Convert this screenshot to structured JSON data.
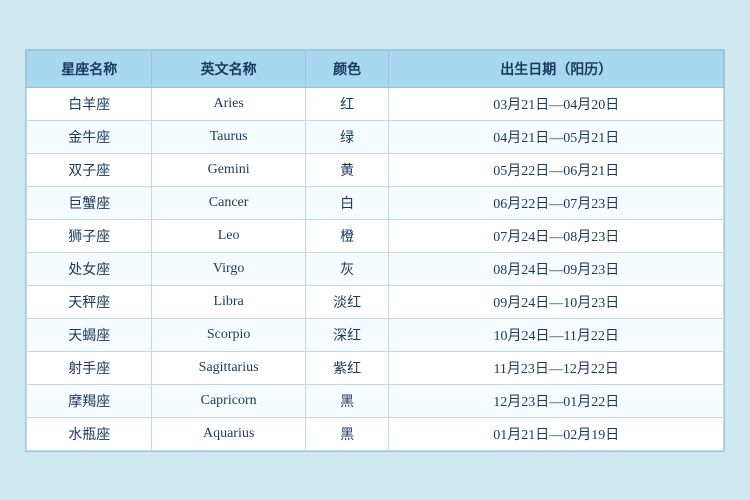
{
  "table": {
    "headers": [
      {
        "id": "col-chinese-name",
        "label": "星座名称"
      },
      {
        "id": "col-english-name",
        "label": "英文名称"
      },
      {
        "id": "col-color",
        "label": "颜色"
      },
      {
        "id": "col-birth-date",
        "label": "出生日期（阳历）"
      }
    ],
    "rows": [
      {
        "chinese": "白羊座",
        "english": "Aries",
        "color": "红",
        "date": "03月21日—04月20日"
      },
      {
        "chinese": "金牛座",
        "english": "Taurus",
        "color": "绿",
        "date": "04月21日—05月21日"
      },
      {
        "chinese": "双子座",
        "english": "Gemini",
        "color": "黄",
        "date": "05月22日—06月21日"
      },
      {
        "chinese": "巨蟹座",
        "english": "Cancer",
        "color": "白",
        "date": "06月22日—07月23日"
      },
      {
        "chinese": "狮子座",
        "english": "Leo",
        "color": "橙",
        "date": "07月24日—08月23日"
      },
      {
        "chinese": "处女座",
        "english": "Virgo",
        "color": "灰",
        "date": "08月24日—09月23日"
      },
      {
        "chinese": "天秤座",
        "english": "Libra",
        "color": "淡红",
        "date": "09月24日—10月23日"
      },
      {
        "chinese": "天蝎座",
        "english": "Scorpio",
        "color": "深红",
        "date": "10月24日—11月22日"
      },
      {
        "chinese": "射手座",
        "english": "Sagittarius",
        "color": "紫红",
        "date": "11月23日—12月22日"
      },
      {
        "chinese": "摩羯座",
        "english": "Capricorn",
        "color": "黑",
        "date": "12月23日—01月22日"
      },
      {
        "chinese": "水瓶座",
        "english": "Aquarius",
        "color": "黑",
        "date": "01月21日—02月19日"
      }
    ]
  }
}
